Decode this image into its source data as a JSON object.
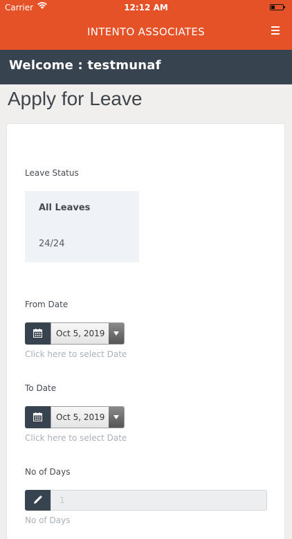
{
  "status_bar": {
    "carrier": "Carrier",
    "time": "12:12 AM"
  },
  "navbar": {
    "title": "INTENTO ASSOCIATES",
    "menu_icon": "hamburger-menu-icon"
  },
  "welcome": {
    "text": "Welcome : testmunaf"
  },
  "page": {
    "title": "Apply for Leave"
  },
  "leave_status": {
    "label": "Leave Status",
    "name": "All Leaves",
    "count": "24/24"
  },
  "from_date": {
    "label": "From Date",
    "value": "Oct 5, 2019",
    "hint": "Click here to select Date"
  },
  "to_date": {
    "label": "To Date",
    "value": "Oct 5, 2019",
    "hint": "Click here to select Date"
  },
  "days": {
    "label": "No of Days",
    "value": "1",
    "hint": "No of Days"
  },
  "colors": {
    "brand": "#e65228",
    "dark": "#37434f",
    "status_box": "#eff2f7",
    "hint": "#a9b0b7"
  }
}
